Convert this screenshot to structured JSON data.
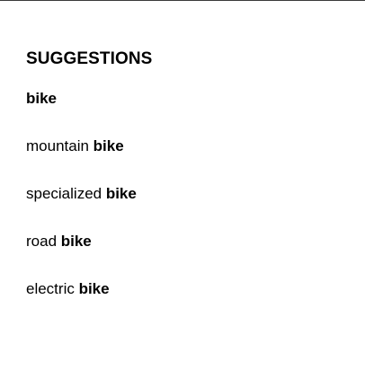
{
  "suggestions_panel": {
    "heading": "SUGGESTIONS",
    "items": [
      {
        "prefix": "",
        "match": "bike"
      },
      {
        "prefix": "mountain ",
        "match": "bike"
      },
      {
        "prefix": "specialized ",
        "match": "bike"
      },
      {
        "prefix": "road ",
        "match": "bike"
      },
      {
        "prefix": "electric ",
        "match": "bike"
      }
    ]
  }
}
